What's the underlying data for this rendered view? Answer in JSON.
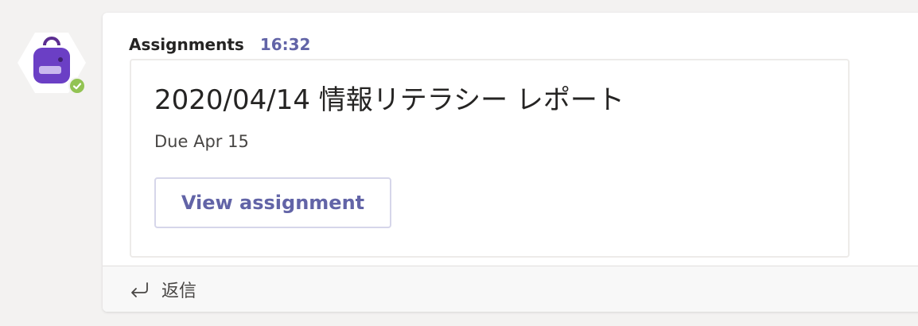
{
  "message": {
    "sender": "Assignments",
    "time": "16:32",
    "card": {
      "title": "2020/04/14 情報リテラシー レポート",
      "due": "Due Apr 15",
      "button_label": "View assignment"
    },
    "reply_label": "返信"
  },
  "avatar": {
    "icon": "backpack-icon",
    "status": "available",
    "status_color": "#92c353",
    "brand_color": "#6b3fc5"
  },
  "colors": {
    "accent": "#6264a7",
    "background": "#f3f2f1"
  }
}
